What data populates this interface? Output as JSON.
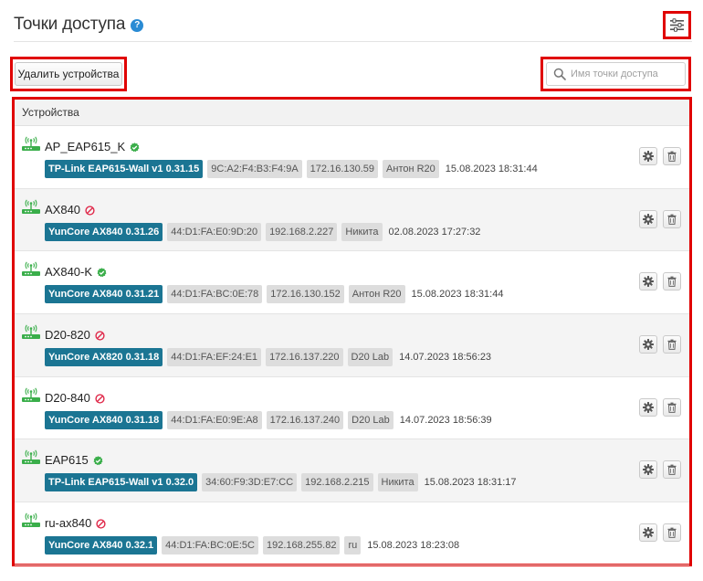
{
  "header": {
    "title": "Точки доступа",
    "help_icon": "question-circle-icon",
    "settings_icon": "sliders-icon"
  },
  "toolbar": {
    "delete_label": "Удалить устройства",
    "search_placeholder": "Имя точки доступа",
    "search_value": ""
  },
  "table": {
    "header": "Устройства"
  },
  "colors": {
    "model_tag": "#1b7593",
    "online": "#3aae4a",
    "offline": "#e0294a",
    "highlight": "#e00000"
  },
  "devices": [
    {
      "name": "AP_EAP615_K",
      "status": "online",
      "model": "TP-Link EAP615-Wall v1 0.31.15",
      "mac": "9C:A2:F4:B3:F4:9A",
      "ip": "172.16.130.59",
      "owner": "Антон R20",
      "date": "15.08.2023 18:31:44"
    },
    {
      "name": "AX840",
      "status": "offline",
      "model": "YunCore AX840 0.31.26",
      "mac": "44:D1:FA:E0:9D:20",
      "ip": "192.168.2.227",
      "owner": "Никита",
      "date": "02.08.2023 17:27:32"
    },
    {
      "name": "AX840-K",
      "status": "online",
      "model": "YunCore AX840 0.31.21",
      "mac": "44:D1:FA:BC:0E:78",
      "ip": "172.16.130.152",
      "owner": "Антон R20",
      "date": "15.08.2023 18:31:44"
    },
    {
      "name": "D20-820",
      "status": "offline",
      "model": "YunCore AX820 0.31.18",
      "mac": "44:D1:FA:EF:24:E1",
      "ip": "172.16.137.220",
      "owner": "D20 Lab",
      "date": "14.07.2023 18:56:23"
    },
    {
      "name": "D20-840",
      "status": "offline",
      "model": "YunCore AX840 0.31.18",
      "mac": "44:D1:FA:E0:9E:A8",
      "ip": "172.16.137.240",
      "owner": "D20 Lab",
      "date": "14.07.2023 18:56:39"
    },
    {
      "name": "EAP615",
      "status": "online",
      "model": "TP-Link EAP615-Wall v1 0.32.0",
      "mac": "34:60:F9:3D:E7:CC",
      "ip": "192.168.2.215",
      "owner": "Никита",
      "date": "15.08.2023 18:31:17"
    },
    {
      "name": "ru-ax840",
      "status": "offline",
      "model": "YunCore AX840 0.32.1",
      "mac": "44:D1:FA:BC:0E:5C",
      "ip": "192.168.255.82",
      "owner": "ru",
      "date": "15.08.2023 18:23:08"
    }
  ]
}
